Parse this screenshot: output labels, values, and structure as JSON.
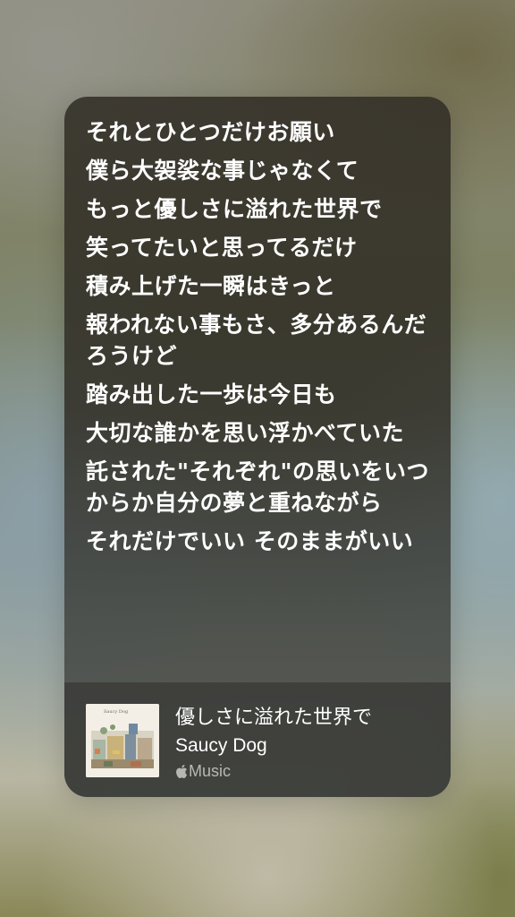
{
  "lyrics": {
    "lines": [
      "それとひとつだけお願い",
      "僕ら大袈裟な事じゃなくて",
      "もっと優しさに溢れた世界で",
      "笑ってたいと思ってるだけ",
      "積み上げた一瞬はきっと",
      "報われない事もさ、多分あるんだろうけど",
      "踏み出した一歩は今日も",
      "大切な誰かを思い浮かべていた",
      "託された\"それぞれ\"の思いをいつからか自分の夢と重ねながら",
      "それだけでいい そのままがいい"
    ]
  },
  "player": {
    "track_title": "優しさに溢れた世界で",
    "artist": "Saucy Dog",
    "source_label": "Music",
    "source_icon": "apple-logo-icon"
  },
  "album_art": {
    "cover_text": "Saucy Dog"
  },
  "colors": {
    "lyric_text": "#ffffff",
    "source_text": "#a8a8a4"
  }
}
